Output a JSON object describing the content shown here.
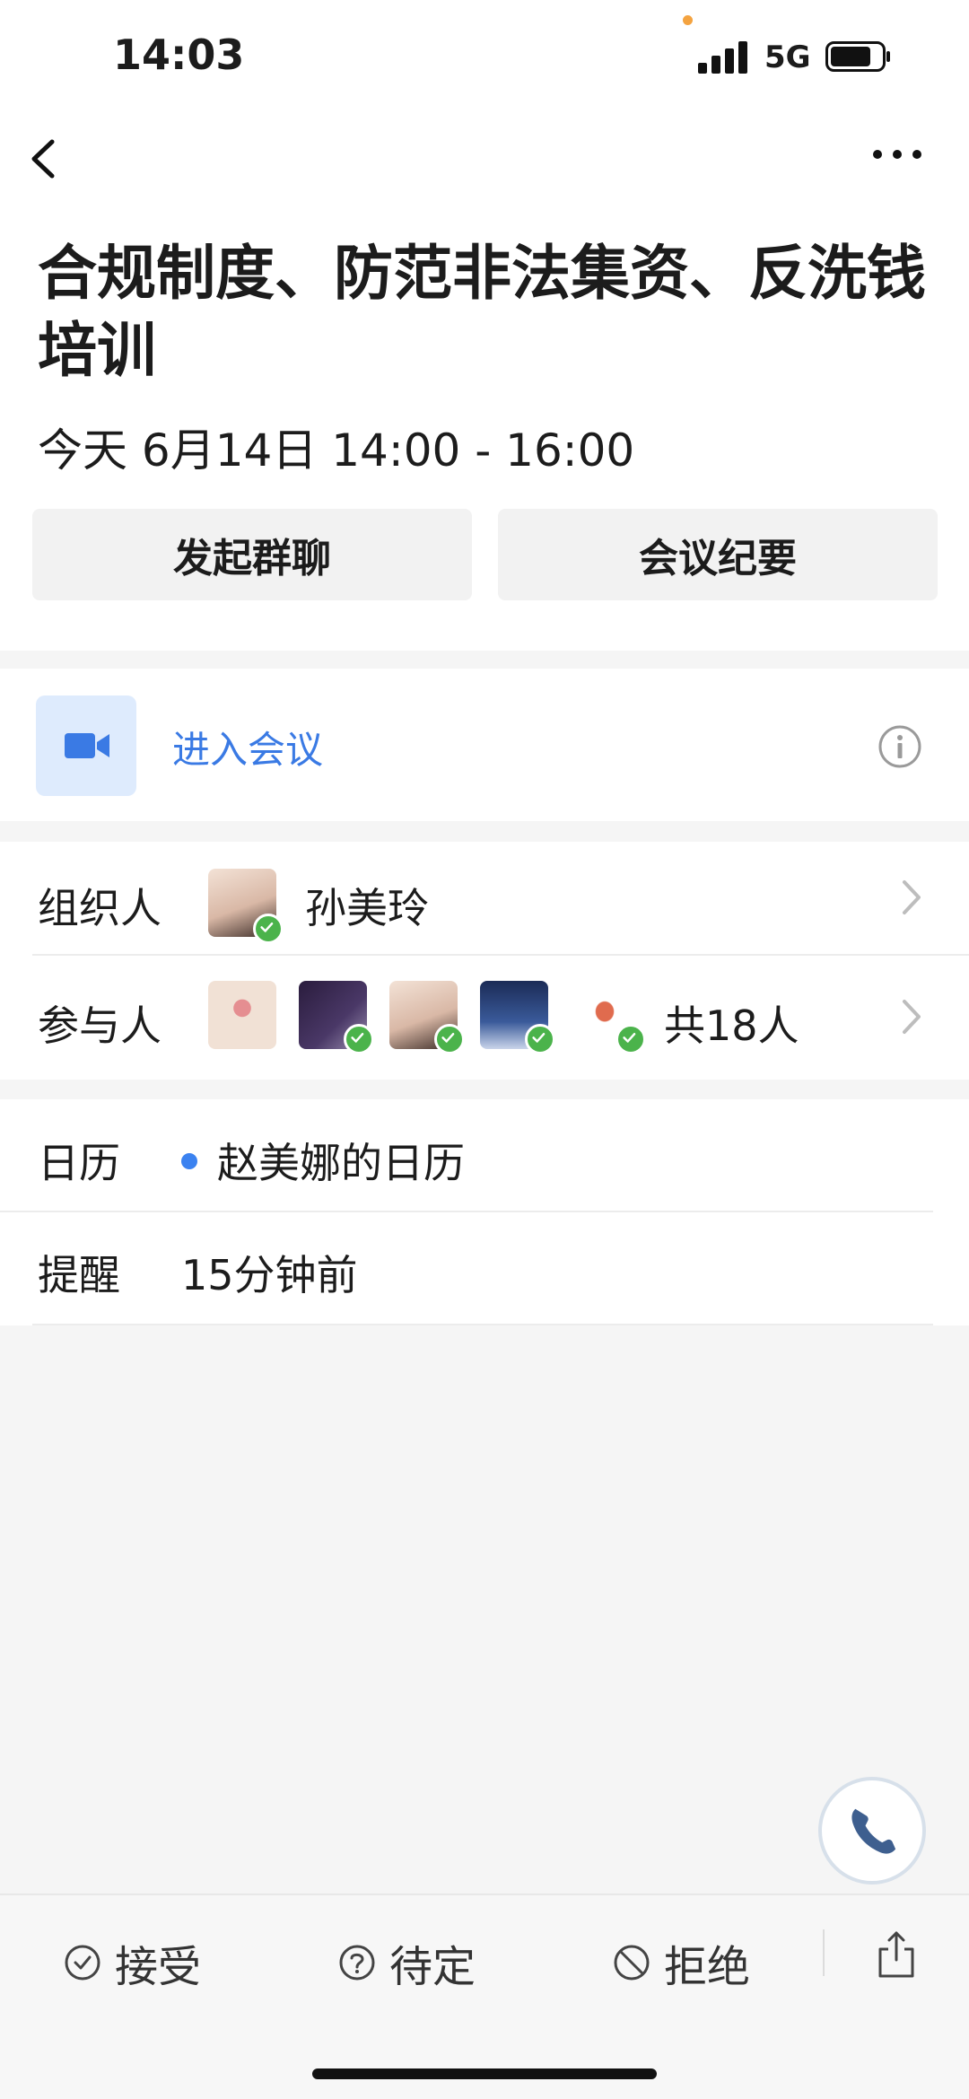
{
  "status": {
    "time": "14:03",
    "network": "5G"
  },
  "event": {
    "title": "合规制度、防范非法集资、反洗钱培训",
    "time": "今天 6月14日 14:00 - 16:00"
  },
  "buttons": {
    "group_chat": "发起群聊",
    "minutes": "会议纪要"
  },
  "meeting": {
    "join_label": "进入会议"
  },
  "organizer": {
    "label": "组织人",
    "name": "孙美玲"
  },
  "participants": {
    "label": "参与人",
    "count_text": "共18人"
  },
  "calendar": {
    "label": "日历",
    "value": "赵美娜的日历",
    "dot_color": "#3b82f0"
  },
  "reminder": {
    "label": "提醒",
    "value": "15分钟前"
  },
  "actions": {
    "accept": "接受",
    "tentative": "待定",
    "decline": "拒绝"
  },
  "colors": {
    "accent": "#3a7ae4",
    "check": "#4bb34b"
  }
}
